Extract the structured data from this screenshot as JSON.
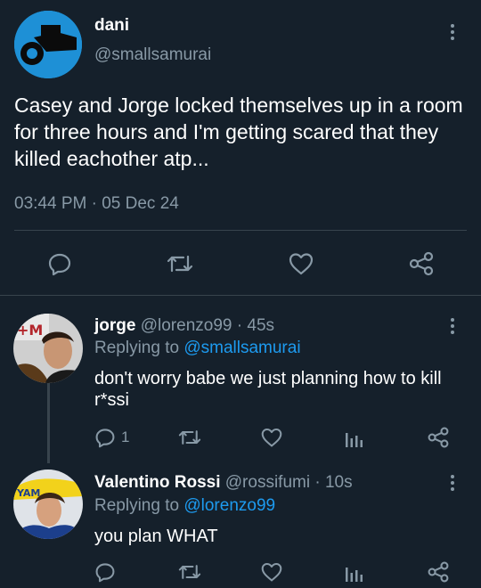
{
  "main_tweet": {
    "author_name": "dani",
    "author_handle": "@smallsamurai",
    "text": "Casey and Jorge locked themselves up in a room for three hours and I'm getting scared that they killed eachother atp...",
    "timestamp": "03:44 PM · 05 Dec 24",
    "actions": [
      "reply-icon",
      "retweet-icon",
      "like-icon",
      "share-icon"
    ]
  },
  "replies": [
    {
      "author_name": "jorge",
      "author_handle": "@lorenzo99",
      "time": "· 45s",
      "replying_prefix": "Replying to",
      "replying_to": "@smallsamurai",
      "text": "don't worry babe we just planning how to kill r*ssi",
      "reply_count": "1",
      "actions": [
        "reply-icon",
        "retweet-icon",
        "like-icon",
        "analytics-icon",
        "share-icon"
      ]
    },
    {
      "author_name": "Valentino Rossi",
      "author_handle": "@rossifumi",
      "time": "· 10s",
      "replying_prefix": "Replying to",
      "replying_to": "@lorenzo99",
      "text": "you plan WHAT",
      "reply_count": "",
      "actions": [
        "reply-icon",
        "retweet-icon",
        "like-icon",
        "analytics-icon",
        "share-icon"
      ]
    }
  ],
  "colors": {
    "background": "#15202b",
    "muted": "#8899a6",
    "link": "#1d9bf0",
    "divider": "#38444d"
  }
}
